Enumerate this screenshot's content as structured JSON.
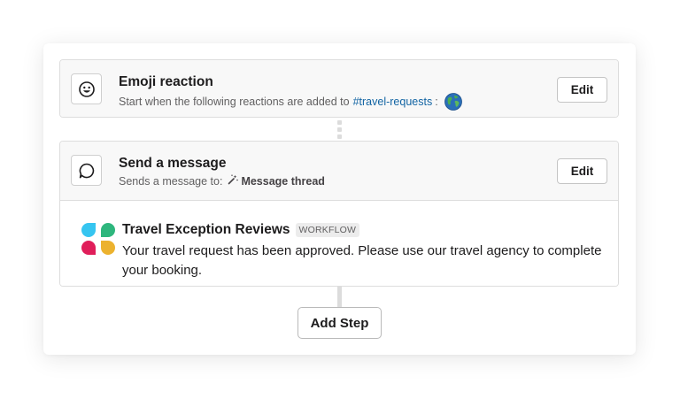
{
  "steps": [
    {
      "title": "Emoji reaction",
      "subtitle_prefix": "Start when the following reactions are added to",
      "channel": "#travel-requests",
      "colon": ":",
      "emoji": "globe-emoji",
      "edit_label": "Edit"
    },
    {
      "title": "Send a message",
      "subtitle_prefix": "Sends a message to:",
      "target": "Message thread",
      "edit_label": "Edit"
    }
  ],
  "message": {
    "app_name": "Travel Exception Reviews",
    "badge": "WORKFLOW",
    "text": "Your travel request has been approved. Please use our travel agency to complete your booking."
  },
  "add_step_label": "Add Step",
  "colors": {
    "link": "#1264a3",
    "logo_blue": "#36c5f0",
    "logo_green": "#2eb67d",
    "logo_red": "#e01e5a",
    "logo_yellow": "#ecb22e"
  }
}
